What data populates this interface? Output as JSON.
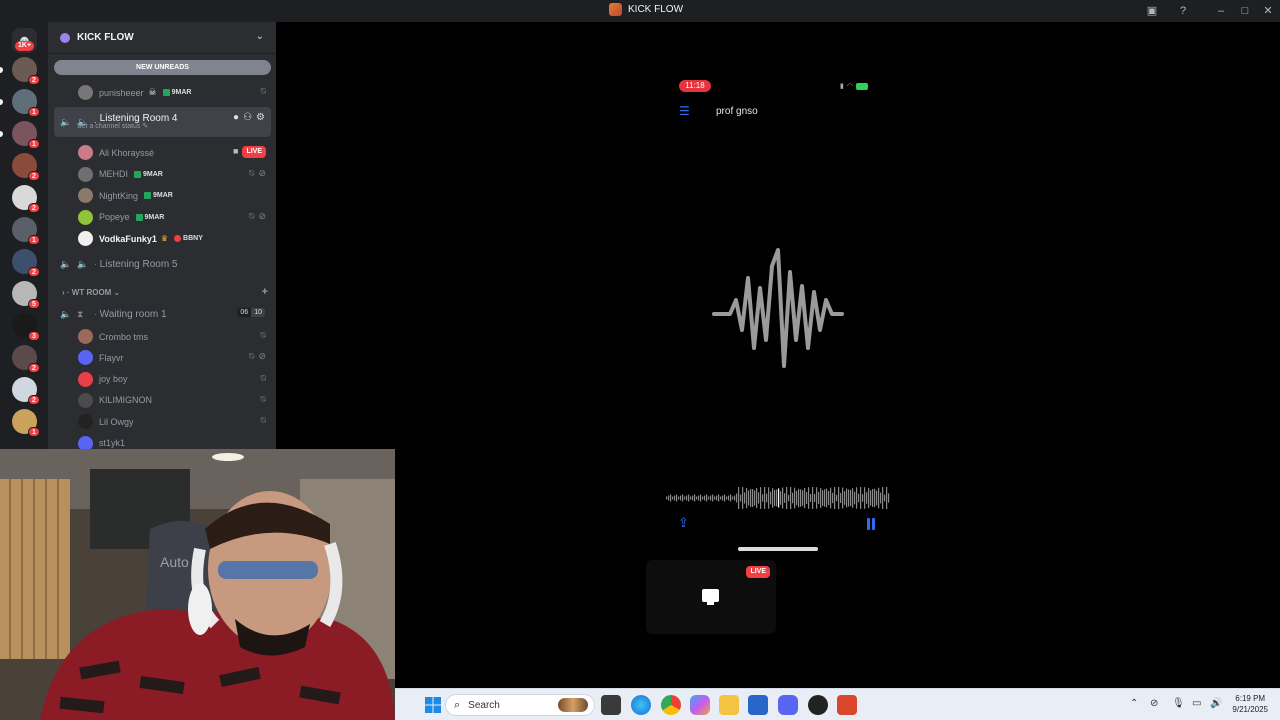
{
  "window": {
    "title": "KICK FLOW"
  },
  "rail": {
    "dm_badge": "1K+",
    "servers": [
      {
        "badge": "2",
        "color": "#6b5a52"
      },
      {
        "badge": "1",
        "color": "#5f6f7a"
      },
      {
        "badge": "1",
        "color": "#7a5560"
      },
      {
        "badge": "2",
        "color": "#8a4b3b"
      },
      {
        "badge": "2",
        "color": "#d9d9d9"
      },
      {
        "badge": "1",
        "color": "#59606a"
      },
      {
        "badge": "2",
        "color": "#3e4f6b"
      },
      {
        "badge": "5",
        "color": "#b7b7b7"
      },
      {
        "badge": "3",
        "color": "#1a1a1a"
      },
      {
        "badge": "2",
        "color": "#5a4a4a"
      },
      {
        "badge": "2",
        "color": "#cfd8e0"
      },
      {
        "badge": "1",
        "color": "#c9a35b"
      }
    ]
  },
  "sidebar": {
    "server_name": "KICK FLOW",
    "new_unreads": "NEW UNREADS",
    "user_punisheeer": {
      "name": "punisheeer",
      "tag": "9MAR"
    },
    "listening_room_4": {
      "name": "Listening Room 4",
      "status": "Set a channel status"
    },
    "room4_members": [
      {
        "name": "Ali Khorayssé",
        "tag": "",
        "live": "LIVE"
      },
      {
        "name": "MEHDI",
        "tag": "9MAR"
      },
      {
        "name": "NightKing",
        "tag": "9MAR"
      },
      {
        "name": "Popeye",
        "tag": "9MAR"
      },
      {
        "name": "VodkaFunky1",
        "tag": "BBNY"
      }
    ],
    "listening_room_5": "Listening Room 5",
    "category": "WT ROOM",
    "waiting_room_1": {
      "name": "Waiting room 1",
      "count_a": "06",
      "count_b": "10"
    },
    "waiting_members": [
      "Crombo tms",
      "Flayvr",
      "joy boy",
      "KILIMIGNON",
      "Lil Owgy",
      "st1yk1"
    ]
  },
  "stream": {
    "phone_time": "11:18",
    "recording_title": "prof gnso",
    "live_label": "LIVE"
  },
  "taskbar": {
    "search_placeholder": "Search",
    "time": "6:19 PM",
    "date": "9/21/2025"
  }
}
